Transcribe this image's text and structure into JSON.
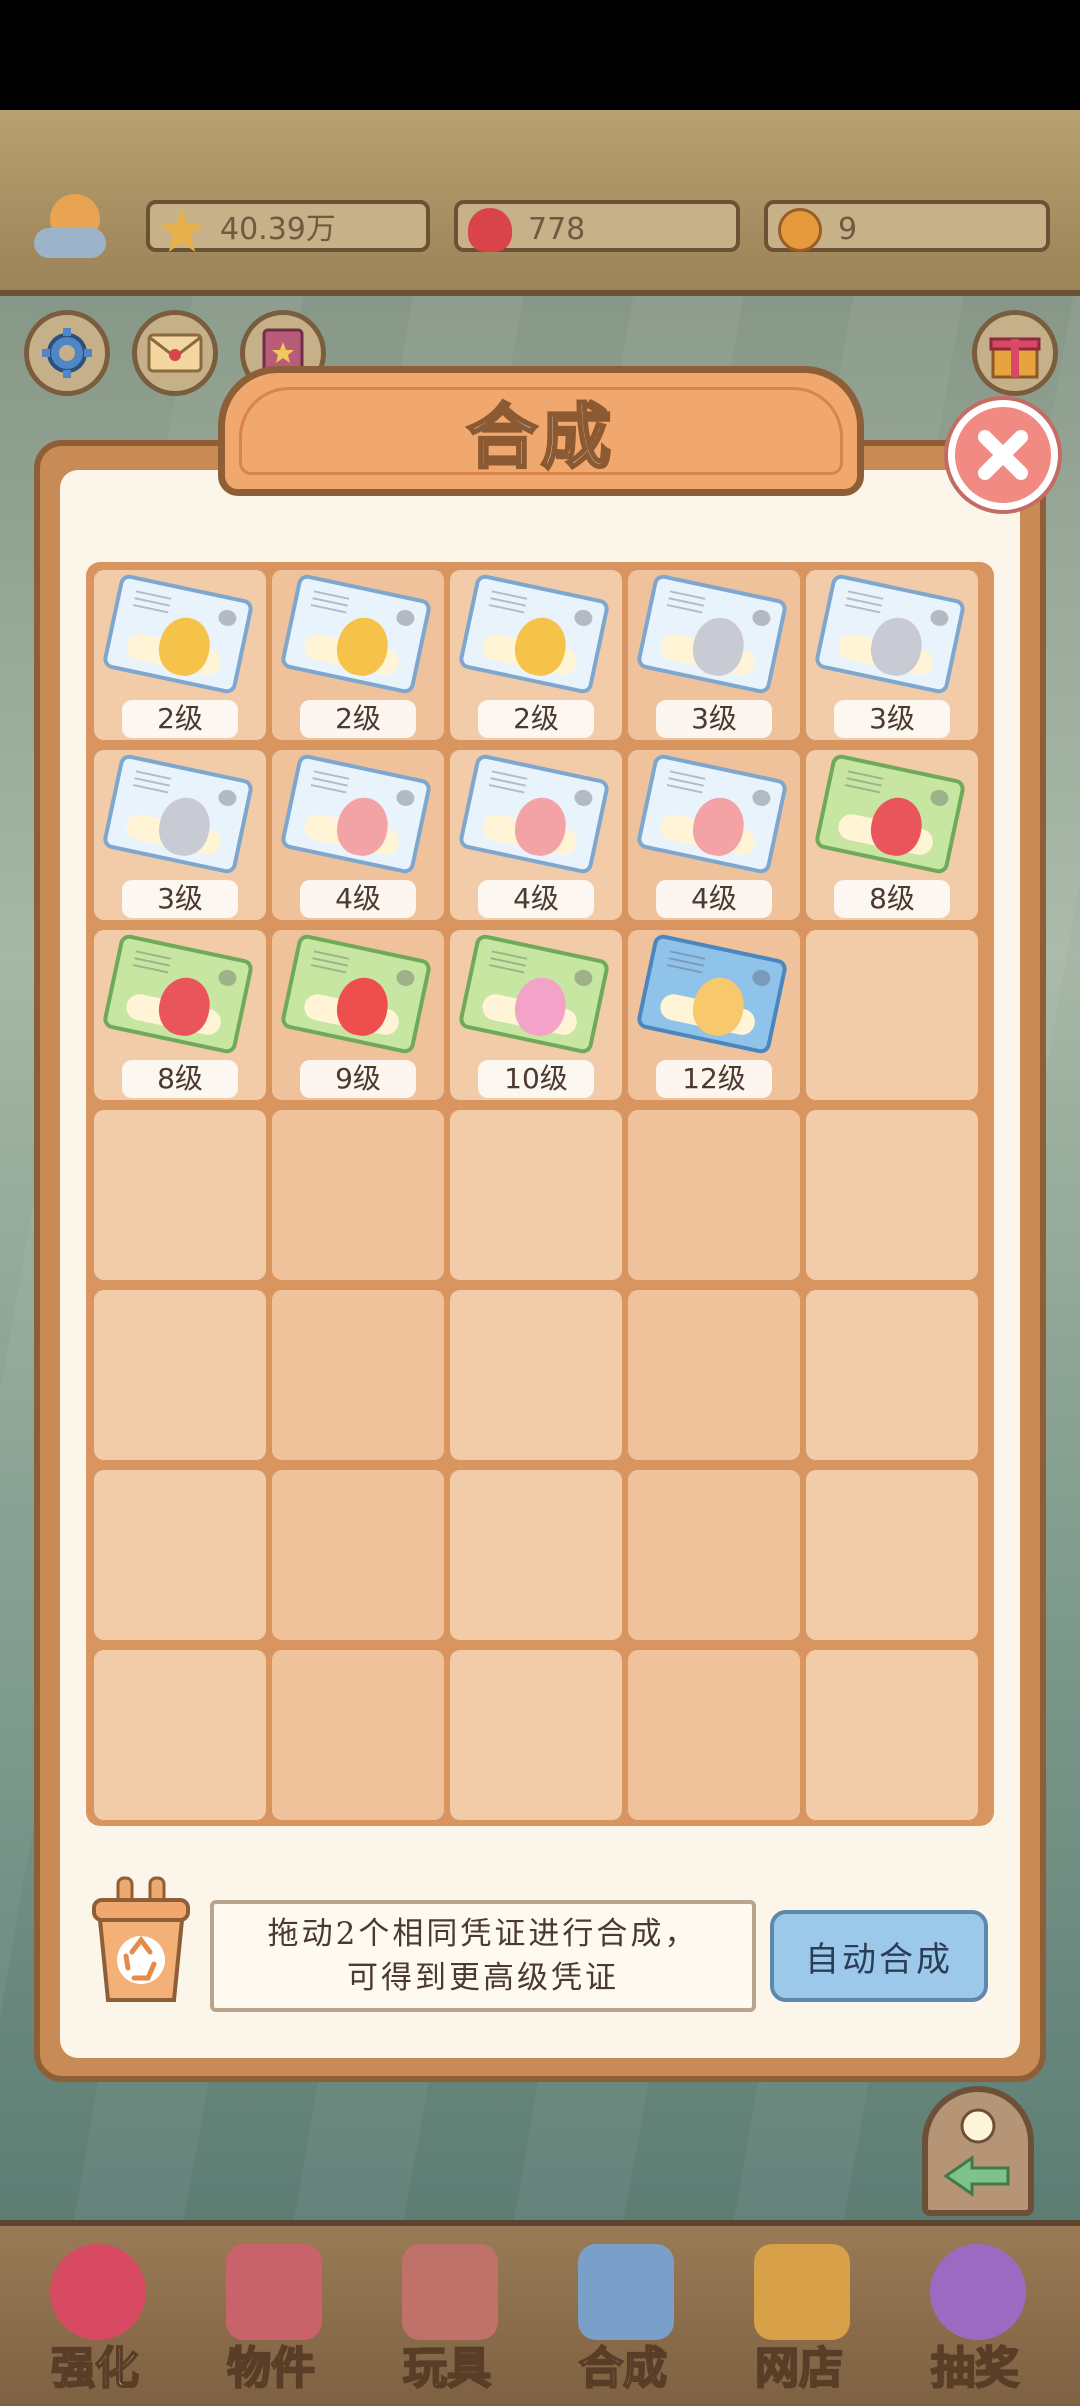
{
  "resources": {
    "stars": "40.39万",
    "hearts": "778",
    "coins": "9"
  },
  "panel": {
    "title": "合成",
    "hint_line1": "拖动2个相同凭证进行合成，",
    "hint_line2": "可得到更高级凭证",
    "auto_button": "自动合成"
  },
  "cards": [
    {
      "level": "2级",
      "style": "blue",
      "egg": "#f5c24a"
    },
    {
      "level": "2级",
      "style": "blue",
      "egg": "#f5c24a"
    },
    {
      "level": "2级",
      "style": "blue",
      "egg": "#f5c24a"
    },
    {
      "level": "3级",
      "style": "blue",
      "egg": "#c9cbd4"
    },
    {
      "level": "3级",
      "style": "blue",
      "egg": "#c9cbd4"
    },
    {
      "level": "3级",
      "style": "blue",
      "egg": "#c9cbd4"
    },
    {
      "level": "4级",
      "style": "blue",
      "egg": "#f3a3a6"
    },
    {
      "level": "4级",
      "style": "blue",
      "egg": "#f3a3a6"
    },
    {
      "level": "4级",
      "style": "blue",
      "egg": "#f3a3a6"
    },
    {
      "level": "8级",
      "style": "green",
      "egg": "#e9555a"
    },
    {
      "level": "8级",
      "style": "green",
      "egg": "#e9555a"
    },
    {
      "level": "9级",
      "style": "green",
      "egg": "#ee4e4e"
    },
    {
      "level": "10级",
      "style": "green",
      "egg": "#f3a3c8"
    },
    {
      "level": "12级",
      "style": "sky",
      "egg": "#f7c86c"
    }
  ],
  "nav": [
    {
      "label": "强化",
      "icon": "lollipop-icon"
    },
    {
      "label": "物件",
      "icon": "piano-icon"
    },
    {
      "label": "玩具",
      "icon": "cat-house-icon"
    },
    {
      "label": "合成",
      "icon": "cards-icon"
    },
    {
      "label": "网店",
      "icon": "shop-basket-icon"
    },
    {
      "label": "抽奖",
      "icon": "prize-wheel-icon"
    }
  ],
  "colors": {
    "panel": "#c98b55",
    "grid": "#d9955f",
    "cell_light": "#f2cba8",
    "cell_dark": "#efc29c",
    "auto_button": "#9cc8ea"
  }
}
